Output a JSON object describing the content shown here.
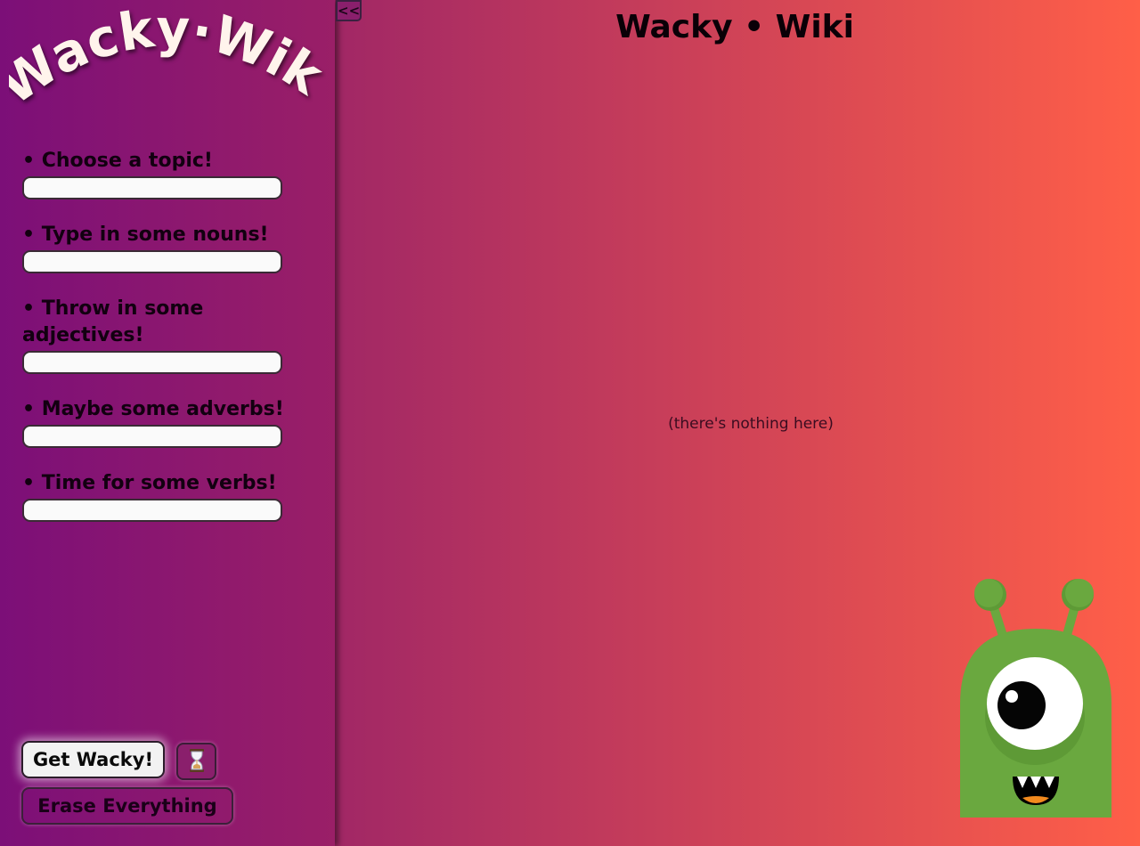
{
  "app": {
    "logo_text": "Wacky·Wiki",
    "title": "Wacky • Wiki",
    "empty_message": "(there's nothing here)"
  },
  "sidebar": {
    "fields": [
      {
        "label": "• Choose a topic!",
        "value": "",
        "placeholder": ""
      },
      {
        "label": "• Type in some nouns!",
        "value": "",
        "placeholder": ""
      },
      {
        "label": "• Throw in some adjectives!",
        "value": "",
        "placeholder": ""
      },
      {
        "label": "• Maybe some adverbs!",
        "value": "",
        "placeholder": ""
      },
      {
        "label": "• Time for some verbs!",
        "value": "",
        "placeholder": ""
      }
    ],
    "get_button_label": "Get Wacky!",
    "timer_icon": "hourglass-icon",
    "erase_button_label": "Erase Everything"
  },
  "toggle": {
    "collapse_label": "<<"
  },
  "colors": {
    "sidebar_start": "#7c0f78",
    "sidebar_end": "#9a1f67",
    "main_start": "#a2225f",
    "main_end": "#ff5f48",
    "monster_green": "#6aa83f"
  },
  "mascot": {
    "icon": "alien-monster-icon"
  }
}
